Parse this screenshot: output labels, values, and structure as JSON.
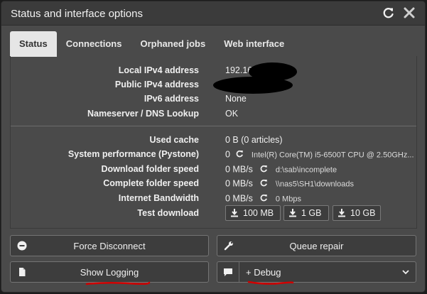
{
  "header": {
    "title": "Status and interface options",
    "refresh_icon": "refresh-icon",
    "close_icon": "close-icon"
  },
  "tabs": [
    {
      "label": "Status",
      "active": true
    },
    {
      "label": "Connections",
      "active": false
    },
    {
      "label": "Orphaned jobs",
      "active": false
    },
    {
      "label": "Web interface",
      "active": false
    }
  ],
  "network": {
    "local_ipv4_label": "Local IPv4 address",
    "local_ipv4_value": "192.16",
    "public_ipv4_label": "Public IPv4 address",
    "ipv6_label": "IPv6 address",
    "ipv6_value": "None",
    "dns_label": "Nameserver / DNS Lookup",
    "dns_value": "OK"
  },
  "system": {
    "used_cache_label": "Used cache",
    "used_cache_value": "0 B (0 articles)",
    "pystone_label": "System performance (Pystone)",
    "pystone_value": "0",
    "cpu_value": "Intel(R) Core(TM) i5-6500T CPU @ 2.50GHz...",
    "download_speed_label": "Download folder speed",
    "download_speed_value": "0 MB/s",
    "download_folder": "d:\\sab\\incomplete",
    "complete_speed_label": "Complete folder speed",
    "complete_speed_value": "0 MB/s",
    "complete_folder": "\\\\nas5\\SH1\\downloads",
    "bandwidth_label": "Internet Bandwidth",
    "bandwidth_value": "0 MB/s",
    "bandwidth_mbps": "0 Mbps",
    "test_download_label": "Test download",
    "test_buttons": [
      "100 MB",
      "1 GB",
      "10 GB"
    ]
  },
  "actions": {
    "force_disconnect": "Force Disconnect",
    "queue_repair": "Queue repair",
    "show_logging": "Show Logging",
    "debug_label": "+ Debug"
  },
  "colors": {
    "modal_bg": "#4a4a4a",
    "header_bg": "#3b3b3b",
    "annotation_red": "#d10000"
  }
}
